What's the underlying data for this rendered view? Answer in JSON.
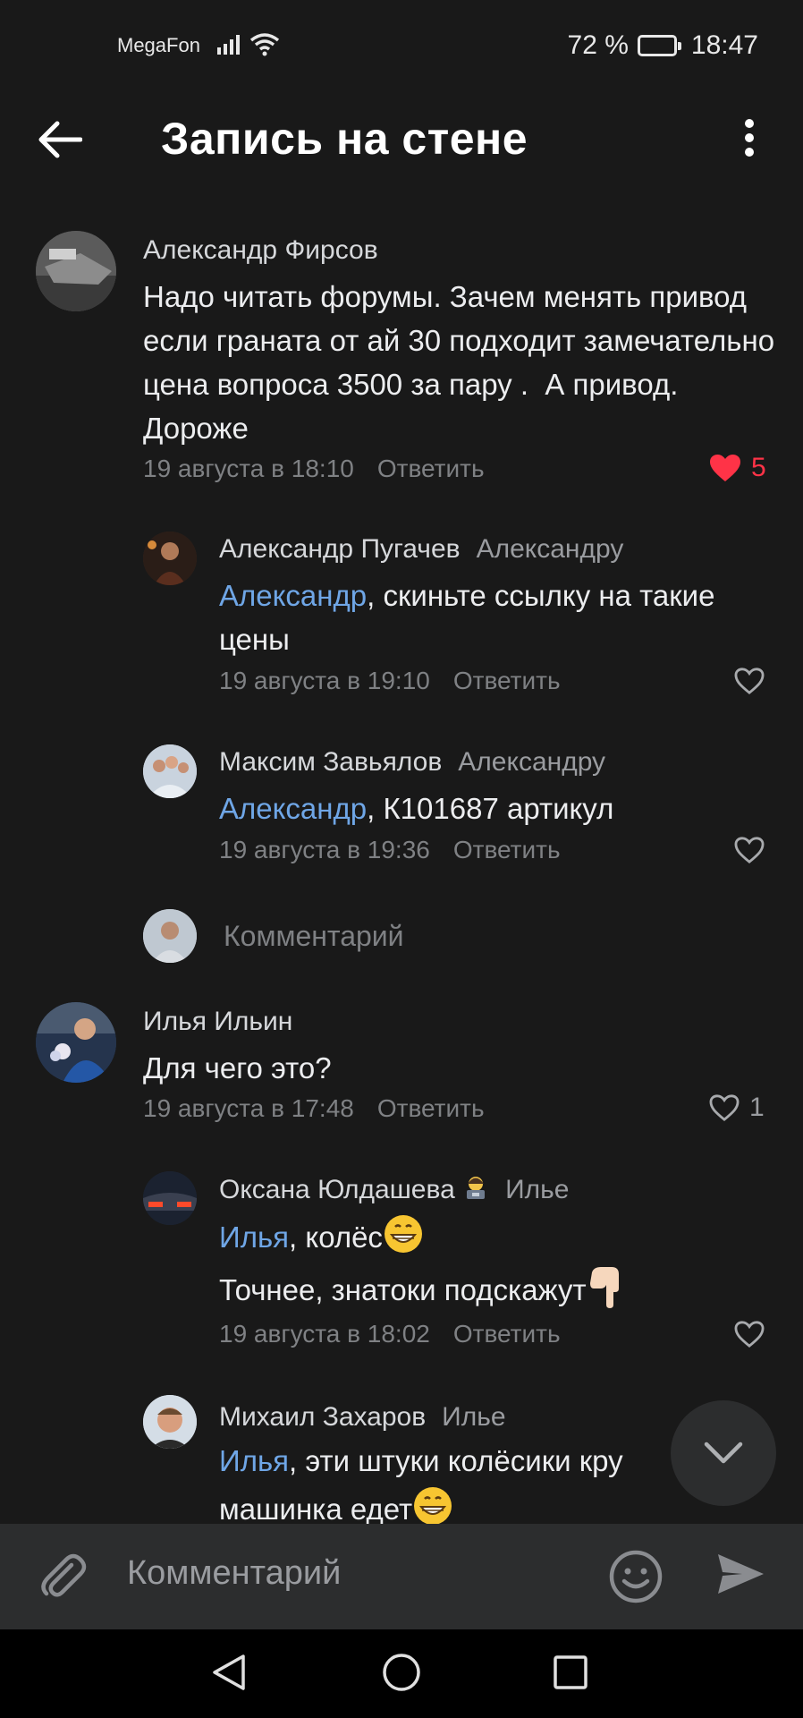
{
  "status_bar": {
    "carrier": "MegaFon",
    "battery_text": "72 %",
    "battery_level": 0.72,
    "time": "18:47"
  },
  "header": {
    "title": "Запись на стене"
  },
  "comments": [
    {
      "author": "Александр Фирсов",
      "text": "Надо читать форумы. Зачем менять привод если граната от ай 30 подходит замечательно  цена вопроса 3500 за пару .  А привод.  Дороже",
      "date": "19 августа в 18:10",
      "reply_label": "Ответить",
      "likes": "5",
      "liked": true
    },
    {
      "author": "Александр Пугачев",
      "reply_to": "Александру",
      "mention": "Александр",
      "text": ", скиньте ссылку на такие цены",
      "date": "19 августа в 19:10",
      "reply_label": "Ответить"
    },
    {
      "author": "Максим Завьялов",
      "reply_to": "Александру",
      "mention": "Александр",
      "text": ", К101687 артикул",
      "date": "19 августа в 19:36",
      "reply_label": "Ответить"
    },
    {
      "author": "Илья Ильин",
      "text": "Для чего это?",
      "date": "19 августа в 17:48",
      "reply_label": "Ответить",
      "likes": "1"
    },
    {
      "author": "Оксана Юлдашева",
      "author_emoji": "woman-technologist-emoji",
      "reply_to": "Илье",
      "mention": "Илья",
      "text": ", колёс",
      "text_emoji": "grinning-face-emoji",
      "text2": "Точнее, знатоки подскажут",
      "text2_emoji": "pointing-down-emoji",
      "date": "19 августа в 18:02",
      "reply_label": "Ответить"
    },
    {
      "author": "Михаил Захаров",
      "reply_to": "Илье",
      "mention": "Илья",
      "text": ", эти штуки колёсики кру",
      "text2": "машинка едет",
      "text2_emoji": "grinning-face-emoji"
    }
  ],
  "thread_input": {
    "placeholder": "Комментарий"
  },
  "composer": {
    "placeholder": "Комментарий"
  },
  "colors": {
    "background": "#191919",
    "accent_link": "#6fa6e6",
    "like_active": "#ff3347",
    "muted": "#7f8184"
  }
}
